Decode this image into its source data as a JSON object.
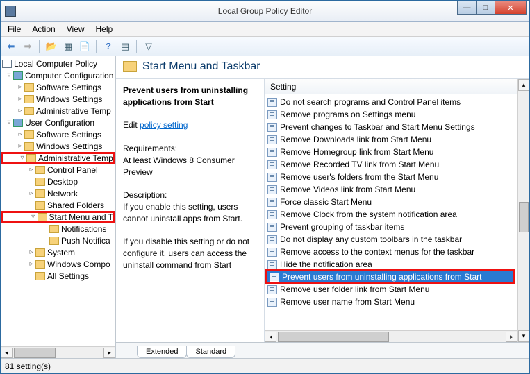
{
  "window": {
    "title": "Local Group Policy Editor"
  },
  "menu": [
    "File",
    "Action",
    "View",
    "Help"
  ],
  "tree": {
    "root": "Local Computer Policy",
    "cc": "Computer Configuration",
    "cc_items": [
      "Software Settings",
      "Windows Settings",
      "Administrative Temp"
    ],
    "uc": "User Configuration",
    "uc_items": [
      "Software Settings",
      "Windows Settings"
    ],
    "at": "Administrative Temp",
    "at_items": [
      "Control Panel",
      "Desktop",
      "Network",
      "Shared Folders"
    ],
    "sm": "Start Menu and T",
    "sm_items": [
      "Notifications",
      "Push Notifica"
    ],
    "tail": [
      "System",
      "Windows Compo",
      "All Settings"
    ]
  },
  "header": {
    "title": "Start Menu and Taskbar"
  },
  "desc": {
    "title": "Prevent users from uninstalling applications from Start",
    "edit_prefix": "Edit ",
    "edit_link": "policy setting ",
    "req_h": "Requirements:",
    "req_v": "At least Windows 8 Consumer Preview",
    "desc_h": "Description:",
    "desc_v1": "If you enable this setting, users cannot uninstall apps from Start.",
    "desc_v2": "If you disable this setting or do not configure it, users can access the uninstall command from Start"
  },
  "list": {
    "column": "Setting",
    "items": [
      "Do not search programs and Control Panel items",
      "Remove programs on Settings menu",
      "Prevent changes to Taskbar and Start Menu Settings",
      "Remove Downloads link from Start Menu",
      "Remove Homegroup link from Start Menu",
      "Remove Recorded TV link from Start Menu",
      "Remove user's folders from the Start Menu",
      "Remove Videos link from Start Menu",
      "Force classic Start Menu",
      "Remove Clock from the system notification area",
      "Prevent grouping of taskbar items",
      "Do not display any custom toolbars in the taskbar",
      "Remove access to the context menus for the taskbar",
      "Hide the notification area",
      "Prevent users from uninstalling applications from Start",
      "Remove user folder link from Start Menu",
      "Remove user name from Start Menu"
    ],
    "selected_index": 14
  },
  "tabs": [
    "Extended",
    "Standard"
  ],
  "status": "81 setting(s)"
}
